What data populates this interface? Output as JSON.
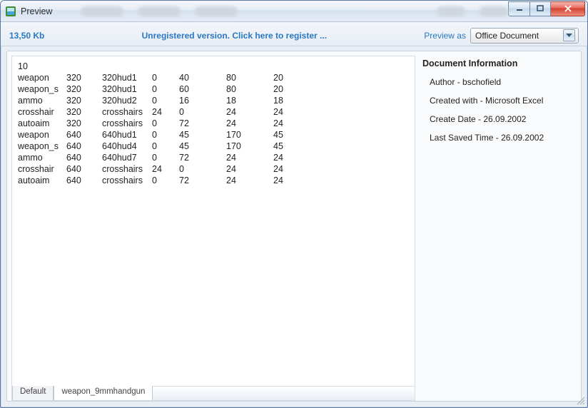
{
  "window": {
    "title": "Preview"
  },
  "toolbar": {
    "size": "13,50 Kb",
    "register_link": "Unregistered version. Click here to register ...",
    "preview_as_label": "Preview as",
    "preview_as_value": "Office Document"
  },
  "sheet": {
    "first_line": "10",
    "rows": [
      {
        "name": "weapon",
        "res": "320",
        "file": "320hud1",
        "v1": "0",
        "v2": "40",
        "v3": "80",
        "v4": "20"
      },
      {
        "name": "weapon_s",
        "res": "320",
        "file": "320hud1",
        "v1": "0",
        "v2": "60",
        "v3": "80",
        "v4": "20"
      },
      {
        "name": "ammo",
        "res": "320",
        "file": "320hud2",
        "v1": "0",
        "v2": "16",
        "v3": "18",
        "v4": "18"
      },
      {
        "name": "crosshair",
        "res": "320",
        "file": "crosshairs",
        "v1": "24",
        "v2": "0",
        "v3": "24",
        "v4": "24"
      },
      {
        "name": "autoaim",
        "res": "320",
        "file": "crosshairs",
        "v1": "0",
        "v2": "72",
        "v3": "24",
        "v4": "24"
      },
      {
        "name": "weapon",
        "res": "640",
        "file": "640hud1",
        "v1": "0",
        "v2": "45",
        "v3": "170",
        "v4": "45"
      },
      {
        "name": "weapon_s",
        "res": "640",
        "file": "640hud4",
        "v1": "0",
        "v2": "45",
        "v3": "170",
        "v4": "45"
      },
      {
        "name": "ammo",
        "res": "640",
        "file": "640hud7",
        "v1": "0",
        "v2": "72",
        "v3": "24",
        "v4": "24"
      },
      {
        "name": "crosshair",
        "res": "640",
        "file": "crosshairs",
        "v1": "24",
        "v2": "0",
        "v3": "24",
        "v4": "24"
      },
      {
        "name": "autoaim",
        "res": "640",
        "file": "crosshairs",
        "v1": "0",
        "v2": "72",
        "v3": "24",
        "v4": "24"
      }
    ],
    "tabs": [
      {
        "label": "Default",
        "active": false
      },
      {
        "label": "weapon_9mmhandgun",
        "active": true
      }
    ]
  },
  "docinfo": {
    "heading": "Document Information",
    "author_label": "Author",
    "author_value": "bschofield",
    "created_label": "Created with",
    "created_value": "Microsoft Excel",
    "cdate_label": "Create Date",
    "cdate_value": "26.09.2002",
    "saved_label": "Last Saved Time",
    "saved_value": "26.09.2002"
  }
}
